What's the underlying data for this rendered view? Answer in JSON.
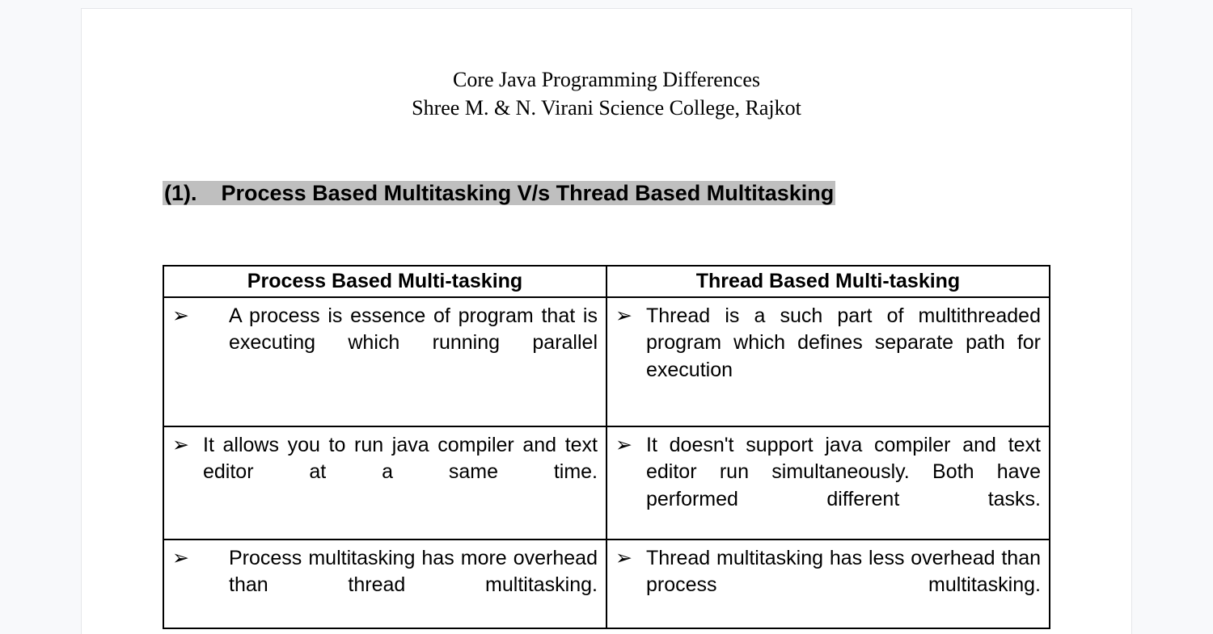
{
  "header": {
    "title_line1": "Core Java Programming Differences",
    "title_line2": "Shree M. & N. Virani Science College, Rajkot"
  },
  "section": {
    "number": "(1).",
    "title": "Process Based Multitasking V/s Thread Based Multitasking"
  },
  "table": {
    "headers": {
      "left": "Process Based Multi-tasking",
      "right": "Thread Based Multi-tasking"
    },
    "bullet": "➢",
    "rows": [
      {
        "left": "A process is essence of program that is executing which running parallel",
        "right": "Thread is a such part of multithreaded program which defines separate path for execution"
      },
      {
        "left": "It allows you to run java compiler and text editor at a same time.",
        "right": "It doesn't support java compiler and text editor run simultaneously. Both have performed different tasks."
      },
      {
        "left": "Process multitasking has more overhead than thread multitasking.",
        "right": "Thread multitasking has less overhead than process multitasking."
      }
    ]
  }
}
